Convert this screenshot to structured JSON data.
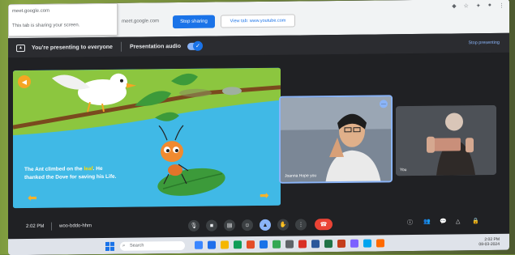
{
  "browser": {
    "popup_line1": "meet.google.com",
    "popup_line2": "This tab is sharing your screen.",
    "share_host": "meet.google.com",
    "stop_sharing_label": "Stop sharing",
    "view_tab_label": "View tab: www.youtube.com"
  },
  "present_bar": {
    "presenting_text": "You're presenting to everyone",
    "audio_label": "Presentation audio",
    "stop_presenting_label": "Stop presenting"
  },
  "slide": {
    "text_line1_a": "The Ant climbed on the ",
    "text_line1_hl": "leaf",
    "text_line1_b": ". He",
    "text_line2": "thanked the Dove for saving his Life."
  },
  "participants": [
    {
      "name": "Joanna Hope you"
    },
    {
      "name": "You"
    }
  ],
  "meeting": {
    "time": "2:02 PM",
    "code": "woo-bddo-hhm"
  },
  "taskbar": {
    "search_placeholder": "Search",
    "tray_time": "2:02 PM",
    "tray_date": "08-03-2024"
  },
  "colors": {
    "accent": "#1a73e8",
    "end_call": "#ea4335",
    "slide_sky": "#40b9e6",
    "slide_grass": "#8cc63f"
  }
}
